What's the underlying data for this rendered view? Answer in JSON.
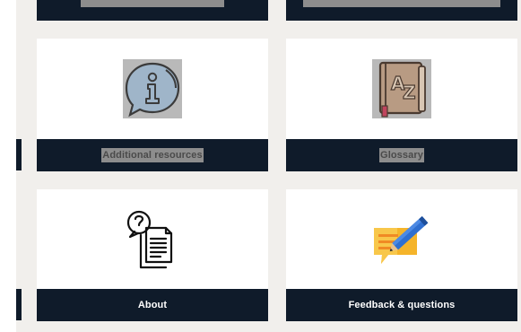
{
  "cards": {
    "top_left": {
      "label": "",
      "icon": "cut-off-icon"
    },
    "top_right": {
      "label": "",
      "icon": "cut-off-icon"
    },
    "additional_resources": {
      "label": "Additional resources",
      "icon": "info-speech-bubble-icon",
      "highlighted": true
    },
    "glossary": {
      "label": "Glossary",
      "icon": "az-book-icon",
      "highlighted": true
    },
    "about": {
      "label": "About",
      "icon": "question-documents-icon"
    },
    "feedback": {
      "label": "Feedback & questions",
      "icon": "note-pencil-icon"
    }
  },
  "colors": {
    "bar": "#0f1b2a",
    "background": "#f1efec",
    "highlight": "#8d8d8d",
    "info_icon": "#9fb5c9",
    "glossary_icon": "#b89b83",
    "feedback_icon": "#f5b42a",
    "pencil": "#2f6fd0"
  }
}
